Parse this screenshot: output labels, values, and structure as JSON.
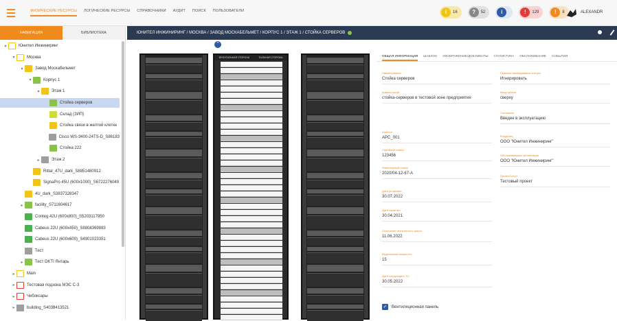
{
  "topnav": {
    "items": [
      {
        "label": "ФИЗИЧЕСКИЕ РЕСУРСЫ",
        "active": true
      },
      {
        "label": "ЛОГИЧЕСКИЕ РЕСУРСЫ"
      },
      {
        "label": "СПРАВОЧНИКИ"
      },
      {
        "label": "АУДИТ"
      },
      {
        "label": "ПОИСК"
      },
      {
        "label": "ПОЛЬЗОВАТЕЛИ"
      }
    ],
    "user": "ALEXANDR"
  },
  "badges": [
    {
      "icon": "info-icon",
      "count": "16",
      "color": "#f0c419",
      "bg": "#f9e9a8"
    },
    {
      "icon": "question-icon",
      "count": "52",
      "color": "#888888",
      "bg": "#e0e0e0"
    },
    {
      "icon": "info-icon",
      "count": "",
      "color": "#2f5aa8",
      "bg": "#dfe6f4"
    },
    {
      "icon": "error-icon",
      "count": "129",
      "color": "#e53935",
      "bg": "#f9d3d2"
    },
    {
      "icon": "warning-icon",
      "count": "8",
      "color": "#f08a1c",
      "bg": "#fbe0c2"
    }
  ],
  "left_tabs": {
    "navigation": "НАВИГАЦИЯ",
    "library": "БИБЛИОТЕКА"
  },
  "tree": [
    {
      "label": "Юнител Инжиниринг",
      "level": 0,
      "arrow": "▾",
      "icon": "folder",
      "color": "#f0c419"
    },
    {
      "label": "Москва",
      "level": 1,
      "arrow": "▾",
      "icon": "folder",
      "color": "#f0c419"
    },
    {
      "label": "Завод Москабельмет",
      "level": 2,
      "arrow": "▾",
      "icon": "building",
      "color": "#f0c419"
    },
    {
      "label": "Корпус 1",
      "level": 3,
      "arrow": "▾",
      "icon": "building",
      "color": "#8bc34a"
    },
    {
      "label": "Этаж 1",
      "level": 4,
      "arrow": "▾",
      "icon": "floor",
      "color": "#f0c419"
    },
    {
      "label": "Стойка серверов",
      "level": 5,
      "arrow": "",
      "icon": "rack",
      "color": "#8bc34a",
      "selected": true
    },
    {
      "label": "Склад (ЗИП)",
      "level": 5,
      "arrow": "",
      "icon": "storage",
      "color": "#cddc39"
    },
    {
      "label": "Стойка связи в желтой клетке",
      "level": 5,
      "arrow": "",
      "icon": "rack",
      "color": "#f0c419"
    },
    {
      "label": "Cisco WS-3400-24TS-D_S86183",
      "level": 5,
      "arrow": "",
      "icon": "device",
      "color": "#9e9e9e"
    },
    {
      "label": "Стойка 222",
      "level": 5,
      "arrow": "",
      "icon": "rack",
      "color": "#8bc34a"
    },
    {
      "label": "Этаж 2",
      "level": 4,
      "arrow": "▸",
      "icon": "floor",
      "color": "#9e9e9e"
    },
    {
      "label": "Rittal_47U_dark_S8851480912",
      "level": 3,
      "arrow": "",
      "icon": "rack",
      "color": "#f0c419"
    },
    {
      "label": "SignaPro 45U (600x1000)_S6722276049",
      "level": 3,
      "arrow": "",
      "icon": "rack",
      "color": "#f0c419"
    },
    {
      "label": "4U_dark_S3837328347",
      "level": 2,
      "arrow": "",
      "icon": "rack",
      "color": "#f0c419"
    },
    {
      "label": "facility_S711604617",
      "level": 2,
      "arrow": "▸",
      "icon": "building",
      "color": "#8bc34a"
    },
    {
      "label": "Conteg 42U (600x800)_S5203117950",
      "level": 2,
      "arrow": "",
      "icon": "rack",
      "color": "#4caf50"
    },
    {
      "label": "Cabeus 22U (600x450)_S8804369883",
      "level": 2,
      "arrow": "",
      "icon": "rack",
      "color": "#4caf50"
    },
    {
      "label": "Cabeus 22U (600x600)_S4901023351",
      "level": 2,
      "arrow": "",
      "icon": "rack",
      "color": "#4caf50"
    },
    {
      "label": "Тест",
      "level": 2,
      "arrow": "",
      "icon": "building",
      "color": "#9e9e9e"
    },
    {
      "label": "Тест DKTI Янтарь",
      "level": 2,
      "arrow": "▸",
      "icon": "building",
      "color": "#8bc34a"
    },
    {
      "label": "Main",
      "level": 1,
      "arrow": "▸",
      "icon": "folder",
      "color": "#f0c419"
    },
    {
      "label": "Тестовая подзона МЭС С-3",
      "level": 1,
      "arrow": "▸",
      "icon": "folder",
      "color": "#e53935"
    },
    {
      "label": "Чебоксары",
      "level": 1,
      "arrow": "▸",
      "icon": "folder",
      "color": "#e53935"
    },
    {
      "label": "building_S4038413521",
      "level": 1,
      "arrow": "▸",
      "icon": "building",
      "color": "#9e9e9e"
    }
  ],
  "breadcrumb": "ЮНИТЕЛ ИНЖИНИРИНГ / МОСКВА / ЗАВОД МОСКАБЕЛЬМЕТ / КОРПУС 1 / ЭТАЖ 1 / СТОЙКА СЕРВЕРОВ",
  "rack_header": {
    "left": "ФРОНТАЛЬНАЯ СТОРОНА",
    "right": "ТЫЛЬНАЯ СТОРОНА"
  },
  "detail_tabs": [
    {
      "label": "ОБЩАЯ ИНФОРМАЦИЯ",
      "active": true
    },
    {
      "label": "ШАБЛОН"
    },
    {
      "label": "ИЗОБРАЖЕНИЕ/ДОКУМЕНТЫ"
    },
    {
      "label": "СТАТИСТИКА"
    },
    {
      "label": "ОБСЛУЖИВАНИЕ"
    },
    {
      "label": "СОБЫТИЯ"
    }
  ],
  "fields_left": [
    {
      "label": "Наименование",
      "value": "Стойка серверов"
    },
    {
      "label": "Комментарий",
      "value": "стойка-серверов в тестовой зоне предприятия"
    },
    {
      "label": "Шаблон",
      "value": "APC_001"
    },
    {
      "label": "Серийный номер",
      "value": "123456"
    },
    {
      "label": "Инвентарный номер",
      "value": "2020/04-12-67-А"
    },
    {
      "label": "Дата установки",
      "value": "30.07.2022"
    },
    {
      "label": "Дата гарантии",
      "value": "30.04.2021"
    },
    {
      "label": "Окончание технического цикла",
      "value": "11.06.2022"
    },
    {
      "label": "Выделяемая мощность",
      "value": "15"
    },
    {
      "label": "Дата следующего ТО",
      "value": "30.05.2022"
    }
  ],
  "fields_right": [
    {
      "label": "Правило наследования статуса",
      "value": "Игнорировать"
    },
    {
      "label": "Ввод кабеля",
      "value": "сверху"
    },
    {
      "label": "Состояние",
      "value": "Введен в эксплуатацию"
    },
    {
      "label": "Владелец",
      "value": "ООО \"Юнител Инжиниринг\""
    },
    {
      "label": "Обслуживающая организация",
      "value": "ООО \"Юнител Инжиниринг\""
    },
    {
      "label": "Проект/Титул",
      "value": "Тестовый проект"
    }
  ],
  "ventilation": {
    "label": "Вентиляционная панель",
    "checked": true
  }
}
